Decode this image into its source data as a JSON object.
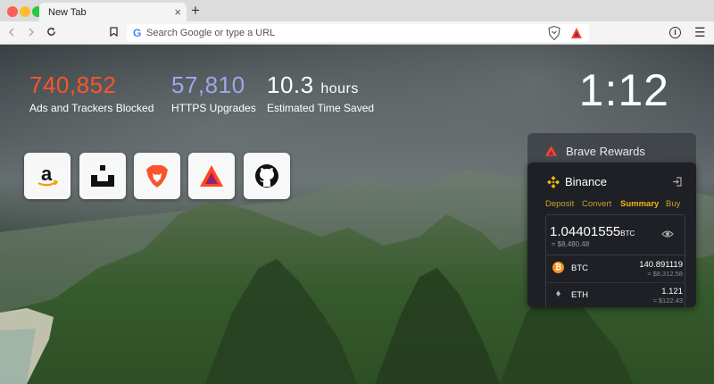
{
  "browser": {
    "tab_title": "New Tab",
    "tab_close": "×",
    "new_tab": "+",
    "url_placeholder": "Search Google or type a URL",
    "info_glyph": "i"
  },
  "stats": {
    "ads_blocked": "740,852",
    "ads_label": "Ads and Trackers Blocked",
    "https_upgrades": "57,810",
    "https_label": "HTTPS Upgrades",
    "time_saved": "10.3",
    "time_unit": "hours",
    "time_label": "Estimated Time Saved"
  },
  "clock": "1:12",
  "top_sites": [
    {
      "name": "amazon-icon"
    },
    {
      "name": "unstop-icon"
    },
    {
      "name": "brave-lion-icon"
    },
    {
      "name": "bat-triangle-icon"
    },
    {
      "name": "github-icon"
    }
  ],
  "rewards": {
    "title": "Brave Rewards"
  },
  "binance": {
    "title": "Binance",
    "tabs": [
      "Deposit",
      "Convert",
      "Summary",
      "Buy"
    ],
    "active_tab": "Summary",
    "balance": "1.04401555",
    "balance_unit": "BTC",
    "balance_usd": "≈ $8,480.48",
    "coins": [
      {
        "symbol": "BTC",
        "glyph": "₿",
        "amount": "140.891119",
        "usd": "≈ $8,312.58"
      },
      {
        "symbol": "ETH",
        "glyph": "♦",
        "amount": "1.121",
        "usd": "≈ $122.43"
      }
    ]
  },
  "colors": {
    "ads_accent": "#fb542b",
    "https_accent": "#a0a5eb",
    "binance_gold": "#f0b90b"
  }
}
